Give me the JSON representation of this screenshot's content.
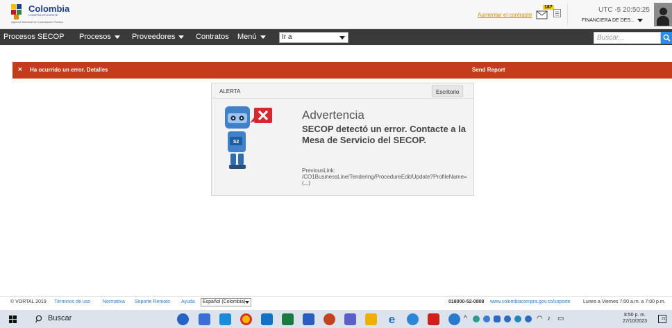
{
  "header": {
    "logo_title": "Colombia",
    "logo_subtitle": "COMPRA EFICIENTE",
    "logo_tagline": "Agencia Nacional de Contratación Pública",
    "contrast_link": "Aumentar el contraste",
    "mail_count": "187",
    "time": "UTC -5 20:50:25",
    "user_company": "FINANCIERA DE DES..."
  },
  "nav": {
    "items": [
      {
        "label": "Procesos SECOP",
        "has_caret": false
      },
      {
        "label": "Procesos",
        "has_caret": true
      },
      {
        "label": "Proveedores",
        "has_caret": true
      },
      {
        "label": "Contratos",
        "has_caret": false
      },
      {
        "label": "Menú",
        "has_caret": true
      }
    ],
    "goto_value": "Ir a",
    "search_placeholder": "Buscar..."
  },
  "error_banner": {
    "icon": "×",
    "message": "Ha ocurrido un error. Detalles",
    "send_report": "Send Report"
  },
  "alert": {
    "title": "ALERTA",
    "desk_button": "Escritorio",
    "warning_title": "Advertencia",
    "warning_body": "SECOP detectó un error. Contacte a la Mesa de Servicio del SECOP.",
    "robot_tag": "S2",
    "previous_link_label": "PreviousLink:",
    "previous_link_value": "/CO1BusinessLine/Tendering/ProcedureEdit/Update?ProfileName= (...)"
  },
  "footer": {
    "copyright": "© VORTAL 2019",
    "links": [
      "Términos de uso",
      "Normativa",
      "Soporte Remoto",
      "Ayuda"
    ],
    "language": "Español (Colombia)",
    "phone": "018000-52-0808",
    "support_site": "www.colombiacompra.gov.co/soporte",
    "hours": "Lunes a Viernes 7:00 a.m. a 7:00 p.m."
  },
  "taskbar": {
    "search_label": "Buscar",
    "time": "8:50 p. m.",
    "date": "27/10/2023",
    "notification_count": "21"
  },
  "colors": {
    "nav_bg": "#3a3a3a",
    "error_red": "#c43c1a",
    "accent_orange": "#e08a00",
    "link_blue": "#2a7ad1",
    "search_blue": "#2a8ce8"
  }
}
